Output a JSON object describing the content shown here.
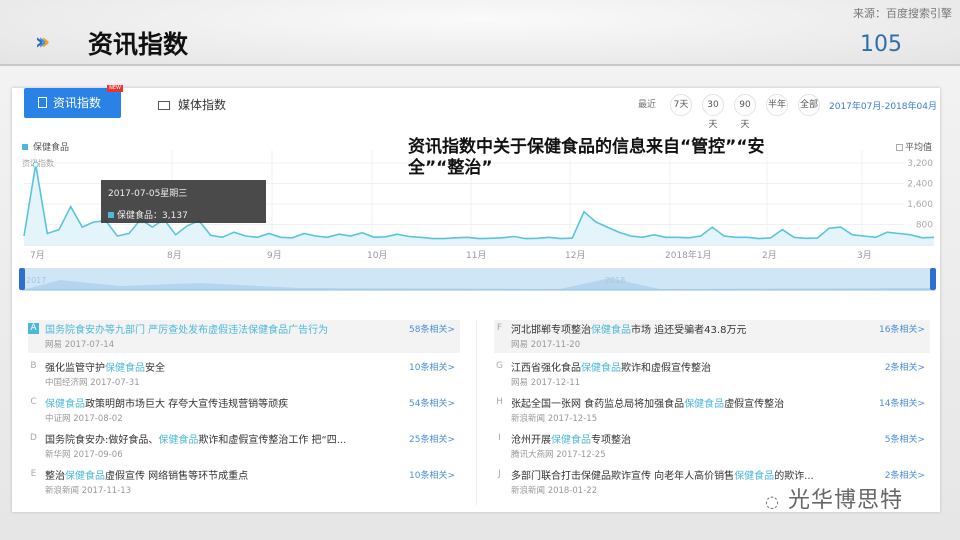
{
  "header": {
    "title": "资讯指数",
    "source": "来源：百度搜索引擎",
    "page_number": "105",
    "arrows": "›››"
  },
  "tabs": [
    {
      "label": "资讯指数",
      "badge": "NEW"
    },
    {
      "label": "媒体指数"
    }
  ],
  "range": {
    "label": "最近",
    "options": [
      "7天",
      "30天",
      "90天",
      "半年",
      "全部"
    ],
    "date_range": "2017年07月-2018年04月"
  },
  "overlay_text": "资讯指数中关于保健食品的信息来自“管控”“安全”“整治”",
  "tooltip": {
    "date": "2017-07-05星期三",
    "series": "保健食品",
    "value": "3,137"
  },
  "average_label": "平均值",
  "navigator": {
    "start": "2017",
    "mid": "2018"
  },
  "chart_data": {
    "type": "area",
    "title": "",
    "series_name": "保健食品",
    "ylabel": "资讯指数",
    "ylim": [
      0,
      3200
    ],
    "yticks": [
      "800",
      "1,600",
      "2,400",
      "3,200"
    ],
    "ytick_values": [
      800,
      1600,
      2400,
      3200
    ],
    "xticks": [
      "7月",
      "8月",
      "9月",
      "10月",
      "11月",
      "12月",
      "2018年1月",
      "2月",
      "3月"
    ],
    "values": [
      350,
      3137,
      450,
      600,
      1500,
      700,
      900,
      950,
      350,
      450,
      1000,
      700,
      1000,
      400,
      750,
      950,
      380,
      300,
      500,
      350,
      300,
      450,
      300,
      280,
      450,
      350,
      300,
      420,
      350,
      480,
      300,
      320,
      420,
      330,
      300,
      250,
      250,
      280,
      300,
      250,
      260,
      280,
      330,
      250,
      260,
      300,
      250,
      270,
      1300,
      900,
      700,
      500,
      350,
      300,
      400,
      300,
      300,
      280,
      350,
      700,
      350,
      300,
      300,
      250,
      280,
      600,
      300,
      260,
      270,
      650,
      700,
      400,
      350,
      300,
      500,
      450,
      400,
      280,
      300
    ]
  },
  "news_left": [
    {
      "letter": "A",
      "pre": "国务院食安办等九部门 严厉查处发布虚假违法保健食品广告行为",
      "kw": "",
      "post": "",
      "meta": "网易 2017-07-14",
      "count": "58条相关>"
    },
    {
      "letter": "B",
      "pre": "强化监管守护",
      "kw": "保健食品",
      "post": "安全",
      "meta": "中国经济网 2017-07-31",
      "count": "10条相关>"
    },
    {
      "letter": "C",
      "pre": "",
      "kw": "保健食品",
      "post": "政策明朗市场巨大 存夸大宣传违规营销等顽疾",
      "meta": "中证网 2017-08-02",
      "count": "54条相关>"
    },
    {
      "letter": "D",
      "pre": "国务院食安办:做好食品、",
      "kw": "保健食品",
      "post": "欺诈和虚假宣传整治工作 把“四...",
      "meta": "新华网 2017-09-06",
      "count": "25条相关>"
    },
    {
      "letter": "E",
      "pre": "整治",
      "kw": "保健食品",
      "post": "虚假宣传 网络销售等环节成重点",
      "meta": "新浪新闻 2017-11-13",
      "count": "10条相关>"
    }
  ],
  "news_right": [
    {
      "letter": "F",
      "pre": "河北邯郸专项整治",
      "kw": "保健食品",
      "post": "市场 追还受骗者43.8万元",
      "meta": "网易 2017-11-20",
      "count": "16条相关>"
    },
    {
      "letter": "G",
      "pre": "江西省强化食品",
      "kw": "保健食品",
      "post": "欺诈和虚假宣传整治",
      "meta": "网易 2017-12-11",
      "count": "2条相关>"
    },
    {
      "letter": "H",
      "pre": "张起全国一张网 食药监总局将加强食品",
      "kw": "保健食品",
      "post": "虚假宣传整治",
      "meta": "新浪新闻 2017-12-15",
      "count": "14条相关>"
    },
    {
      "letter": "I",
      "pre": "沧州开展",
      "kw": "保健食品",
      "post": "专项整治",
      "meta": "腾讯大燕网 2017-12-25",
      "count": "5条相关>"
    },
    {
      "letter": "J",
      "pre": "多部门联合打击保健品欺诈宣传 向老年人高价销售",
      "kw": "保健食品",
      "post": "的欺诈...",
      "meta": "新浪新闻 2018-01-22",
      "count": "2条相关>"
    }
  ],
  "watermark": "光华博思特",
  "colors": {
    "accent": "#2b82e6",
    "line": "#4bb9d9",
    "page_number": "#2e6fa7"
  }
}
